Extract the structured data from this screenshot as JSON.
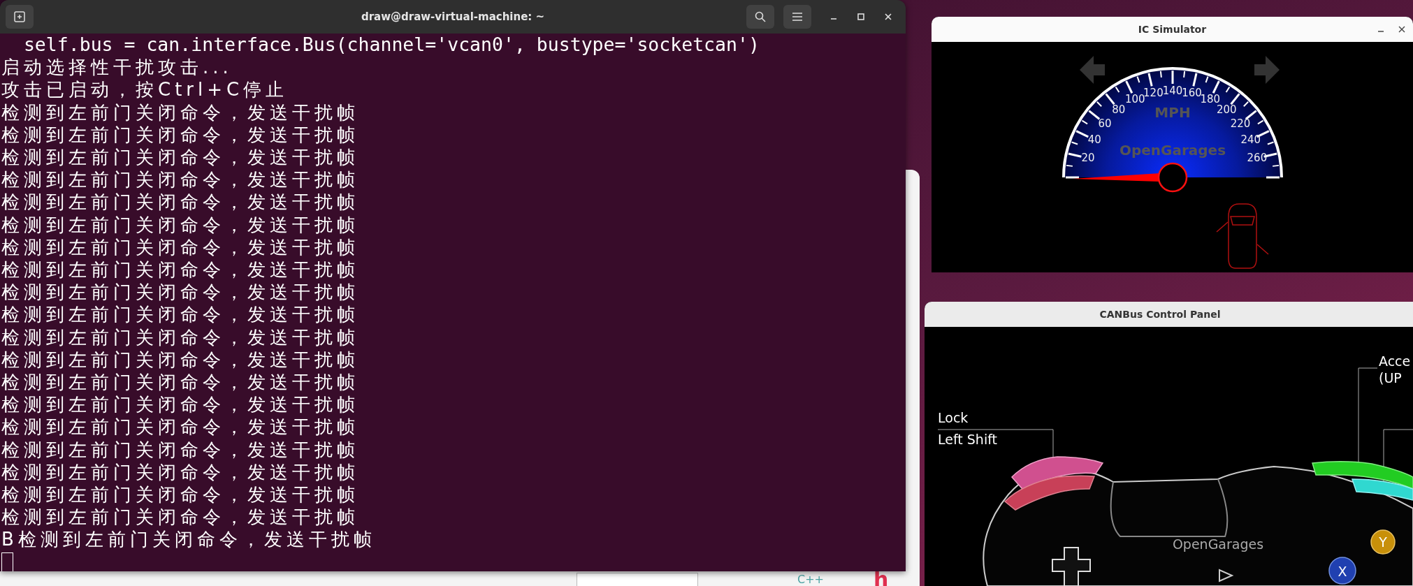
{
  "terminal": {
    "title": "draw@draw-virtual-machine: ~",
    "lines": [
      "  self.bus = can.interface.Bus(channel='vcan0', bustype='socketcan')",
      "启动选择性干扰攻击...",
      "攻击已启动，按Ctrl+C停止",
      "检测到左前门关闭命令，发送干扰帧",
      "检测到左前门关闭命令，发送干扰帧",
      "检测到左前门关闭命令，发送干扰帧",
      "检测到左前门关闭命令，发送干扰帧",
      "检测到左前门关闭命令，发送干扰帧",
      "检测到左前门关闭命令，发送干扰帧",
      "检测到左前门关闭命令，发送干扰帧",
      "检测到左前门关闭命令，发送干扰帧",
      "检测到左前门关闭命令，发送干扰帧",
      "检测到左前门关闭命令，发送干扰帧",
      "检测到左前门关闭命令，发送干扰帧",
      "检测到左前门关闭命令，发送干扰帧",
      "检测到左前门关闭命令，发送干扰帧",
      "检测到左前门关闭命令，发送干扰帧",
      "检测到左前门关闭命令，发送干扰帧",
      "检测到左前门关闭命令，发送干扰帧",
      "检测到左前门关闭命令，发送干扰帧",
      "检测到左前门关闭命令，发送干扰帧",
      "检测到左前门关闭命令，发送干扰帧",
      "B检测到左前门关闭命令，发送干扰帧"
    ]
  },
  "ic_simulator": {
    "title": "IC Simulator",
    "speedometer": {
      "unit": "MPH",
      "brand": "OpenGarages",
      "scale_labels": [
        "20",
        "40",
        "60",
        "80",
        "100",
        "120",
        "140",
        "160",
        "180",
        "200",
        "220",
        "240",
        "260"
      ]
    }
  },
  "control_panel": {
    "title": "CANBus Control Panel",
    "labels": [
      "Lock",
      "Left Shift",
      "Acce",
      "(UP"
    ],
    "brand": "OpenGarages",
    "buttons": [
      "Y",
      "X"
    ]
  },
  "background_window": {
    "items": [
      "C++",
      "h"
    ]
  }
}
